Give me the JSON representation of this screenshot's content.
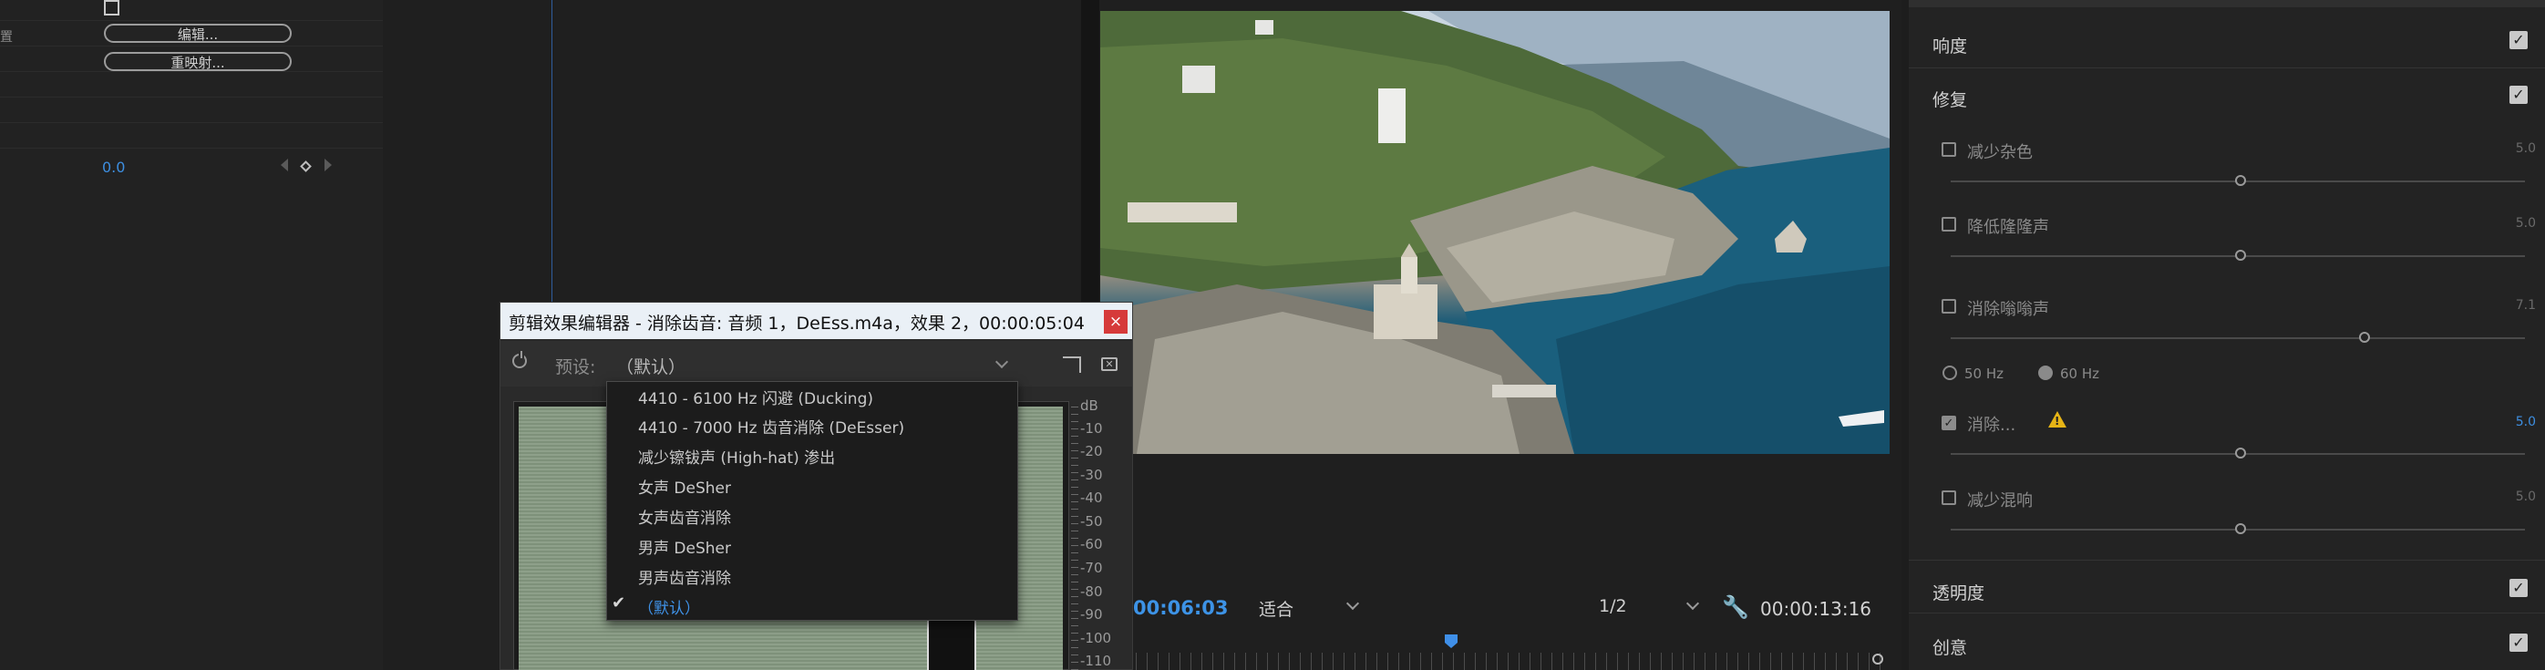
{
  "left_panel": {
    "label_1": "置",
    "edit_button": "编辑...",
    "remap_button": "重映射...",
    "value": "0.0"
  },
  "dialog": {
    "title": "剪辑效果编辑器 - 消除齿音: 音频 1，DeEss.m4a，效果 2，00:00:05:04",
    "close": "×",
    "preset_label": "预设:",
    "preset_value": "（默认）",
    "db_scale": [
      "dB",
      "-10",
      "-20",
      "-30",
      "-40",
      "-50",
      "-60",
      "-70",
      "-80",
      "-90",
      "-100",
      "-110"
    ],
    "preset_options": [
      "4410 - 6100 Hz 闪避 (Ducking)",
      "4410 - 7000 Hz 齿音消除 (DeEsser)",
      "减少镲钹声 (High-hat) 渗出",
      "女声 DeSher",
      "女声齿音消除",
      "男声 DeSher",
      "男声齿音消除",
      "（默认）"
    ],
    "selected_index": 7
  },
  "monitor": {
    "current_time": "00:06:03",
    "fit": "适合",
    "resolution": "1/2",
    "duration": "00:00:13:16"
  },
  "essential_sound": {
    "sections": [
      {
        "label": "响度",
        "checked": true
      },
      {
        "label": "修复",
        "checked": true
      },
      {
        "label": "透明度",
        "checked": true
      },
      {
        "label": "创意",
        "checked": true
      }
    ],
    "repair_items": [
      {
        "label": "减少杂色",
        "checked": false,
        "value": "5.0"
      },
      {
        "label": "降低隆隆声",
        "checked": false,
        "value": "5.0"
      },
      {
        "label": "消除嗡嗡声",
        "checked": false,
        "value": "7.1"
      },
      {
        "label": "消除...",
        "checked": true,
        "value": "5.0"
      },
      {
        "label": "减少混响",
        "checked": false,
        "value": "5.0"
      }
    ],
    "hum_options": [
      "50 Hz",
      "60 Hz"
    ]
  },
  "colors": {
    "accent": "#3d8ee0",
    "dialog_close": "#d63a3a",
    "warning": "#e6b416"
  },
  "icons": [
    "power-icon",
    "chevron-down-icon",
    "route-icon",
    "delete-icon",
    "close-icon",
    "wrench-icon",
    "warning-icon",
    "checkmark-icon"
  ]
}
